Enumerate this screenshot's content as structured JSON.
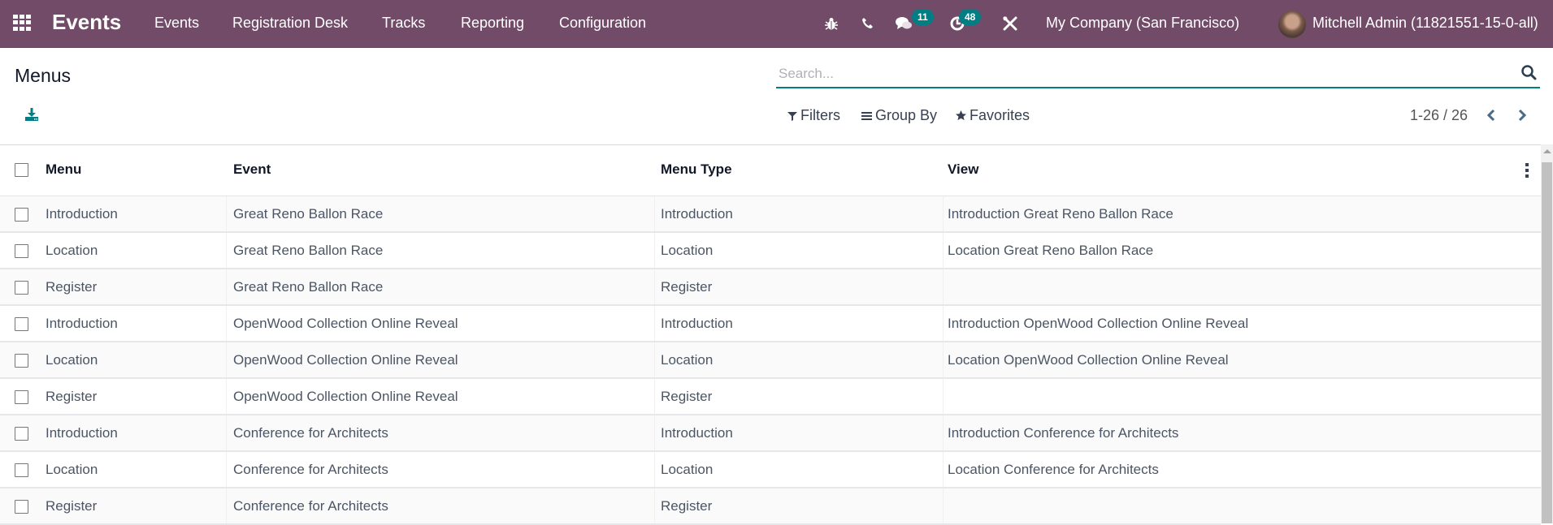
{
  "navbar": {
    "app_name": "Events",
    "menu": [
      "Events",
      "Registration Desk",
      "Tracks",
      "Reporting",
      "Configuration"
    ],
    "icons": [
      "bug-icon",
      "phone-icon",
      "chat-icon",
      "activity-clock-icon",
      "tools-icon"
    ],
    "messages_count": "11",
    "activities_count": "48",
    "company": "My Company (San Francisco)",
    "user": "Mitchell Admin (11821551-15-0-all)",
    "colors": {
      "bar": "#714B67",
      "badge": "#017e84"
    }
  },
  "control_panel": {
    "title": "Menus",
    "search_placeholder": "Search...",
    "search_value": "",
    "filters_label": "Filters",
    "group_by_label": "Group By",
    "favorites_label": "Favorites",
    "pager": "1-26 / 26"
  },
  "table": {
    "columns": [
      "Menu",
      "Event",
      "Menu Type",
      "View"
    ],
    "rows": [
      {
        "menu": "Introduction",
        "event": "Great Reno Ballon Race",
        "menu_type": "Introduction",
        "view": "Introduction Great Reno Ballon Race"
      },
      {
        "menu": "Location",
        "event": "Great Reno Ballon Race",
        "menu_type": "Location",
        "view": "Location Great Reno Ballon Race"
      },
      {
        "menu": "Register",
        "event": "Great Reno Ballon Race",
        "menu_type": "Register",
        "view": ""
      },
      {
        "menu": "Introduction",
        "event": "OpenWood Collection Online Reveal",
        "menu_type": "Introduction",
        "view": "Introduction OpenWood Collection Online Reveal"
      },
      {
        "menu": "Location",
        "event": "OpenWood Collection Online Reveal",
        "menu_type": "Location",
        "view": "Location OpenWood Collection Online Reveal"
      },
      {
        "menu": "Register",
        "event": "OpenWood Collection Online Reveal",
        "menu_type": "Register",
        "view": ""
      },
      {
        "menu": "Introduction",
        "event": "Conference for Architects",
        "menu_type": "Introduction",
        "view": "Introduction Conference for Architects"
      },
      {
        "menu": "Location",
        "event": "Conference for Architects",
        "menu_type": "Location",
        "view": "Location Conference for Architects"
      },
      {
        "menu": "Register",
        "event": "Conference for Architects",
        "menu_type": "Register",
        "view": ""
      }
    ]
  }
}
